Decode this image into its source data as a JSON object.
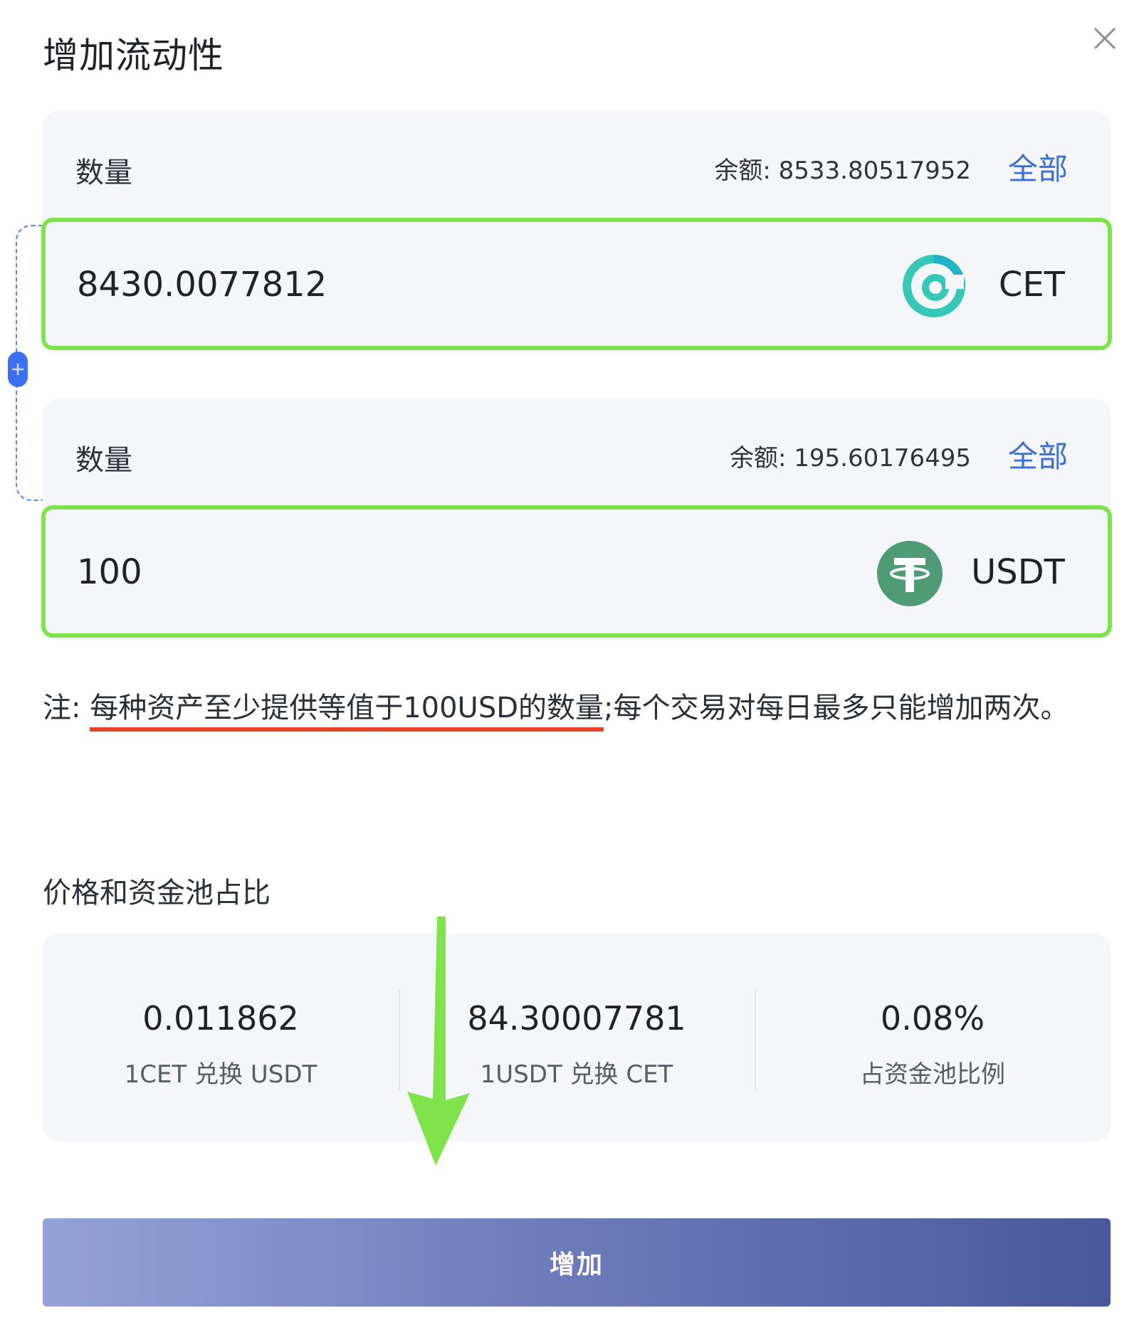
{
  "dialog": {
    "title": "增加流动性"
  },
  "token_a": {
    "quantity_label": "数量",
    "balance_label": "余额:",
    "balance_value": "8533.80517952",
    "all_label": "全部",
    "amount": "8430.0077812",
    "symbol": "CET",
    "icon": "cet-logo-icon",
    "icon_color": "#35c8b7"
  },
  "token_b": {
    "quantity_label": "数量",
    "balance_label": "余额:",
    "balance_value": "195.60176495",
    "all_label": "全部",
    "amount": "100",
    "symbol": "USDT",
    "icon": "usdt-logo-icon",
    "icon_color": "#4e9b76"
  },
  "note": {
    "prefix": "注:",
    "highlight": "每种资产至少提供等值于100USD的数量",
    "rest": ";每个交易对每日最多只能增加两次。"
  },
  "pool": {
    "title": "价格和资金池占比",
    "stats": [
      {
        "value": "0.011862",
        "label": "1CET 兑换 USDT"
      },
      {
        "value": "84.30007781",
        "label": "1USDT 兑换 CET"
      },
      {
        "value": "0.08%",
        "label": "占资金池比例"
      }
    ]
  },
  "submit": {
    "label": "增加"
  },
  "colors": {
    "accent": "#3a6fd8",
    "highlight_border": "#7fe34c",
    "underline": "#e8412b",
    "annotation_arrow": "#7fe34c"
  }
}
